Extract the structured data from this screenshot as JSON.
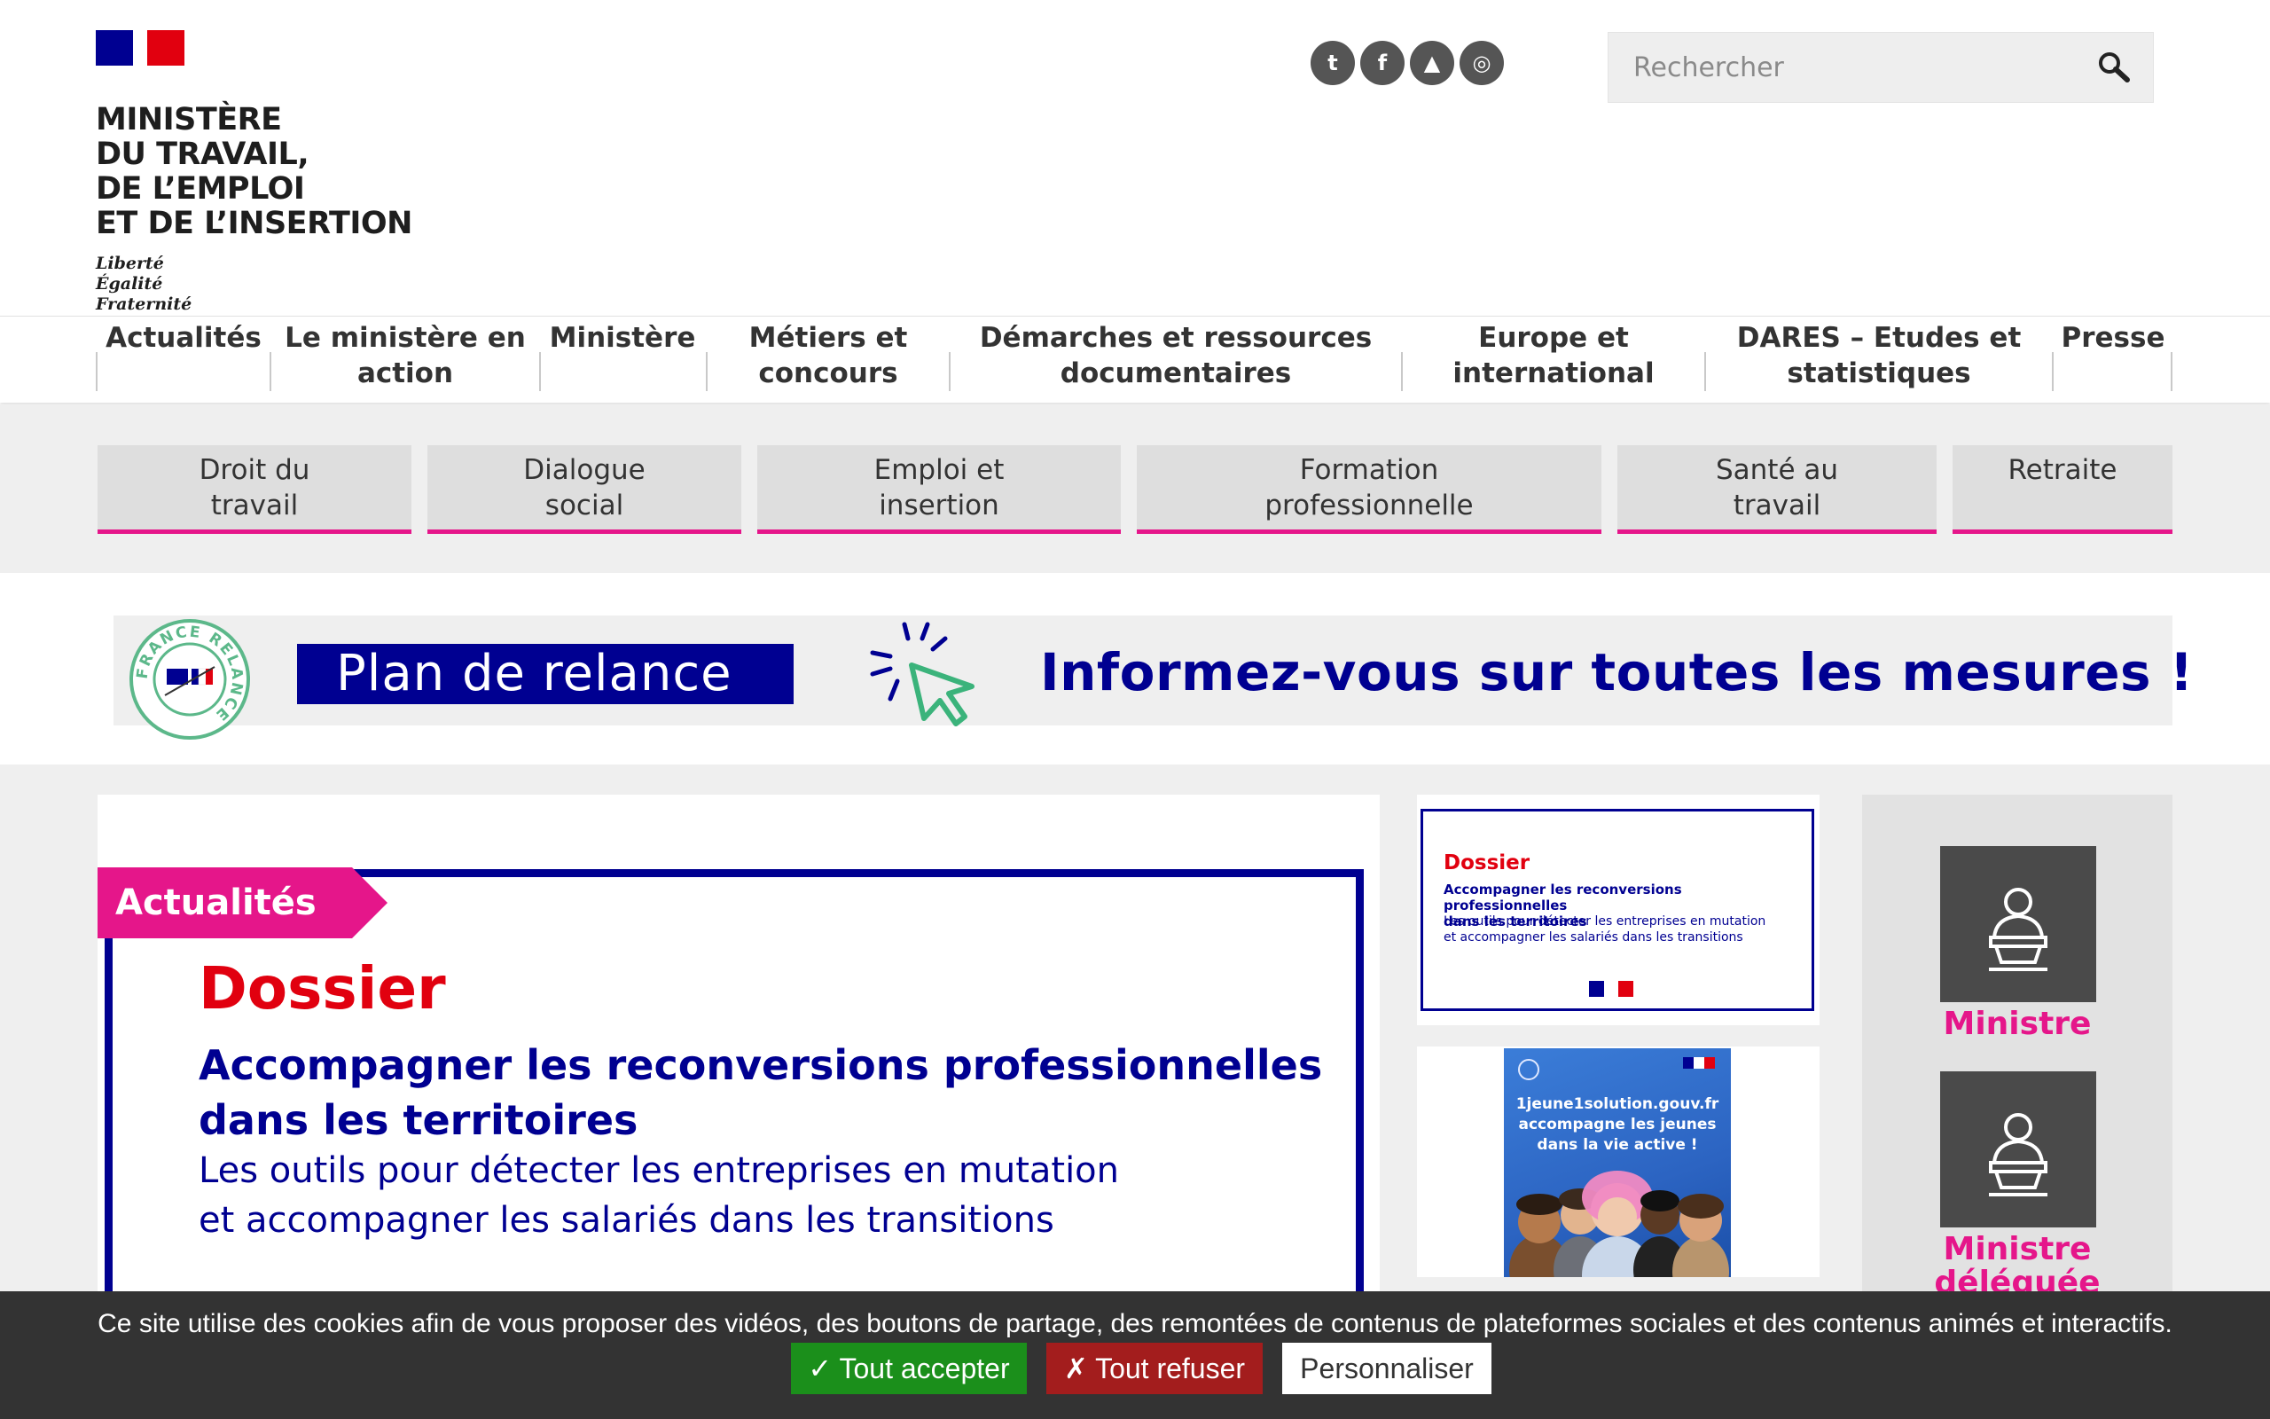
{
  "header": {
    "ministry_name": "MINISTÈRE\nDU TRAVAIL,\nDE L’EMPLOI\nET DE L’INSERTION",
    "motto": "Liberté\nÉgalité\nFraternité",
    "social": [
      {
        "icon": "twitter-icon",
        "glyph": "t"
      },
      {
        "icon": "facebook-icon",
        "glyph": "f"
      },
      {
        "icon": "dailymotion-icon",
        "glyph": "▲"
      },
      {
        "icon": "rss-icon",
        "glyph": "◎"
      }
    ],
    "search_placeholder": "Rechercher"
  },
  "main_nav": [
    "Actualités",
    "Le ministère en\naction",
    "Ministère",
    "Métiers et\nconcours",
    "Démarches et ressources\ndocumentaires",
    "Europe et\ninternational",
    "DARES – Etudes et\nstatistiques",
    "Presse"
  ],
  "themes": [
    "Droit du\ntravail",
    "Dialogue\nsocial",
    "Emploi et\ninsertion",
    "Formation\nprofessionnelle",
    "Santé au\ntravail",
    "Retraite"
  ],
  "banner": {
    "seal_text": "FRANCE RELANCE",
    "plan_label": "Plan de relance",
    "headline": "Informez-vous sur toutes les mesures !"
  },
  "news": {
    "tag": "Actualités",
    "dossier_title": "Dossier",
    "dossier_heading": "Accompagner les reconversions professionnelles\ndans les territoires",
    "dossier_subheading": "Les outils pour détecter les entreprises  en mutation\net accompagner les salariés dans les transitions"
  },
  "side_cards": {
    "card1": {
      "title": "Dossier",
      "heading": "Accompagner les reconversions professionnelles\ndans les territoires",
      "subheading": "Les outils pour détecter les entreprises  en mutation\net accompagner les salariés dans les transitions"
    },
    "card2": {
      "text": "1jeune1solution.gouv.fr\naccompagne les jeunes\ndans la vie active !"
    }
  },
  "ministres": [
    {
      "label": "Ministre",
      "icon": "minister-podium-icon"
    },
    {
      "label": "Ministre\ndéléguée",
      "icon": "minister-podium-icon"
    }
  ],
  "cookie": {
    "message": "Ce site utilise des cookies afin de vous proposer des vidéos, des boutons de partage, des remontées de contenus de plateformes sociales et des contenus animés et interactifs.",
    "accept": "✓ Tout accepter",
    "refuse": "✗ Tout refuser",
    "customize": "Personnaliser"
  },
  "colors": {
    "brand_blue": "#000091",
    "brand_red": "#e1000f",
    "accent_pink": "#e5168a",
    "accept_green": "#1b8f1b",
    "refuse_red": "#a31d1d"
  }
}
